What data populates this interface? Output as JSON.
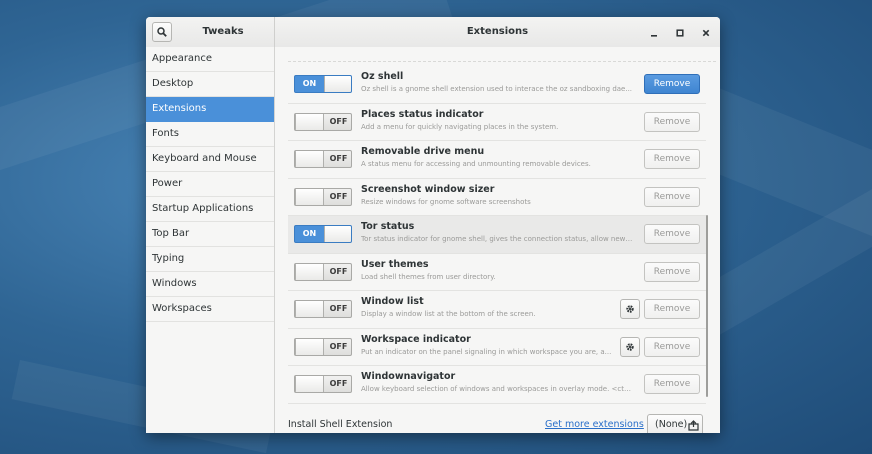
{
  "window": {
    "app_title": "Tweaks",
    "title": "Extensions",
    "controls": {
      "minimize": "minimize-icon",
      "maximize": "maximize-icon",
      "close": "close-icon"
    }
  },
  "sidebar": {
    "items": [
      {
        "label": "Appearance"
      },
      {
        "label": "Desktop"
      },
      {
        "label": "Extensions"
      },
      {
        "label": "Fonts"
      },
      {
        "label": "Keyboard and Mouse"
      },
      {
        "label": "Power"
      },
      {
        "label": "Startup Applications"
      },
      {
        "label": "Top Bar"
      },
      {
        "label": "Typing"
      },
      {
        "label": "Windows"
      },
      {
        "label": "Workspaces"
      }
    ],
    "active": "Extensions"
  },
  "extensions": [
    {
      "name": "Oz shell",
      "description": "Oz shell is a gnome shell extension used to interace the oz sandboxing dae...",
      "state": "ON",
      "has_settings": false,
      "remove_label": "Remove"
    },
    {
      "name": "Places status indicator",
      "description": "Add a menu for quickly navigating places in the system.",
      "state": "OFF",
      "has_settings": false,
      "remove_label": "Remove"
    },
    {
      "name": "Removable drive menu",
      "description": "A status menu for accessing and unmounting removable devices.",
      "state": "OFF",
      "has_settings": false,
      "remove_label": "Remove"
    },
    {
      "name": "Screenshot window sizer",
      "description": "Resize windows for gnome software screenshots",
      "state": "OFF",
      "has_settings": false,
      "remove_label": "Remove"
    },
    {
      "name": "Tor status",
      "description": "Tor status indicator for gnome shell, gives the connection status, allow new i...",
      "state": "ON",
      "has_settings": false,
      "remove_label": "Remove"
    },
    {
      "name": "User themes",
      "description": "Load shell themes from user directory.",
      "state": "OFF",
      "has_settings": false,
      "remove_label": "Remove"
    },
    {
      "name": "Window list",
      "description": "Display a window list at the bottom of the screen.",
      "state": "OFF",
      "has_settings": true,
      "remove_label": "Remove"
    },
    {
      "name": "Workspace indicator",
      "description": "Put an indicator on the panel signaling in which workspace you are, a...",
      "state": "OFF",
      "has_settings": true,
      "remove_label": "Remove"
    },
    {
      "name": "Windownavigator",
      "description": "Allow keyboard selection of windows and workspaces in overlay mode. <ctrl>...",
      "state": "OFF",
      "has_settings": false,
      "remove_label": "Remove"
    }
  ],
  "footer": {
    "install_label": "Install Shell Extension",
    "get_more_label": "Get more extensions",
    "file_chooser_label": "(None)"
  },
  "colors": {
    "accent": "#4a90d9",
    "link": "#2a6fc9"
  }
}
